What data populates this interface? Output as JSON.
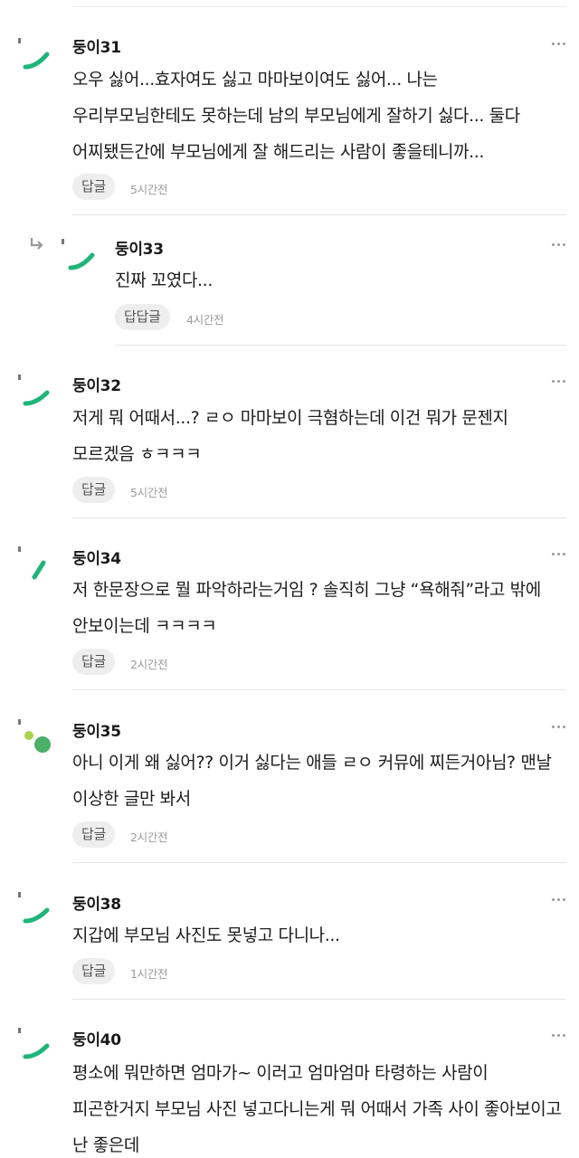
{
  "comments": [
    {
      "nickname": "둥이31",
      "text": "오우 싫어...효자여도 싫고 마마보이여도 싫어... 나는 우리부모님한테도 못하는데 남의 부모님에게 잘하기 싫다... 둘다 어찌됐든간에 부모님에게 잘 해드리는 사람이 좋을테니까...",
      "reply_label": "답글",
      "time": "5시간전"
    },
    {
      "nickname": "둥이33",
      "text": "진짜 꼬였다...",
      "reply_label": "답답글",
      "time": "4시간전"
    },
    {
      "nickname": "둥이32",
      "text": "저게 뭐 어때서...? ㄹㅇ 마마보이 극혐하는데 이건 뭐가 문젠지 모르겠음 ㅎㅋㅋㅋ",
      "reply_label": "답글",
      "time": "5시간전"
    },
    {
      "nickname": "둥이34",
      "text": "저 한문장으로 뭘 파악하라는거임 ? 솔직히 그냥 “욕해줘”라고 밖에 안보이는데 ㅋㅋㅋㅋ",
      "reply_label": "답글",
      "time": "2시간전"
    },
    {
      "nickname": "둥이35",
      "text": "아니 이게 왜 싫어?? 이거 싫다는 애들 ㄹㅇ 커뮤에 찌든거아님? 맨날 이상한 글만 봐서",
      "reply_label": "답글",
      "time": "2시간전"
    },
    {
      "nickname": "둥이38",
      "text": "지갑에 부모님 사진도 못넣고 다니나...",
      "reply_label": "답글",
      "time": "1시간전"
    },
    {
      "nickname": "둥이40",
      "text": "평소에 뭐만하면 엄마가~ 이러고 엄마엄마 타령하는 사람이 피곤한거지 부모님 사진 넣고다니는게 뭐 어때서 가족 사이 좋아보이고 난 좋은데",
      "reply_label": "",
      "time": ""
    }
  ],
  "icons": {
    "more": "more-options-icon",
    "reply_arrow": "reply-arrow-icon",
    "avatar": "avatar-icon"
  },
  "colors": {
    "accent_green": "#1fb57a",
    "dot_green": "#4caf6a",
    "dot_light_green": "#a6d64a",
    "muted_text": "#9b9b9b",
    "reply_bg": "#eeeeee"
  }
}
